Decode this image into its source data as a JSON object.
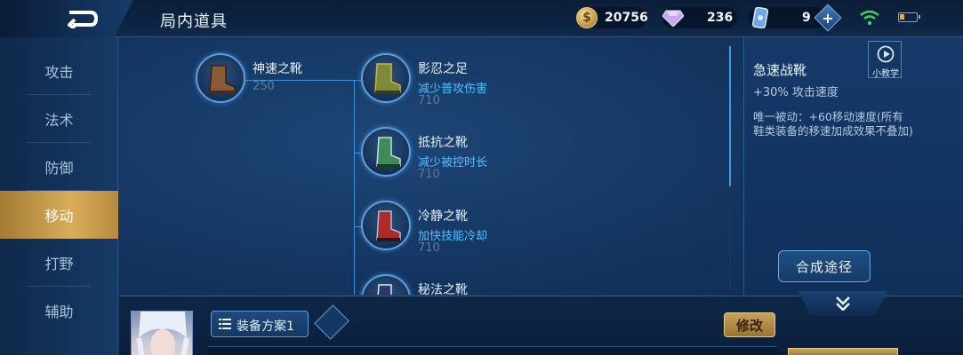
{
  "header": {
    "title": "局内道具",
    "currencies": {
      "gold": "20756",
      "gems": "236",
      "tickets": "9"
    },
    "battery_level": 0.3
  },
  "sidebar": {
    "items": [
      {
        "label": "攻击",
        "active": false
      },
      {
        "label": "法术",
        "active": false
      },
      {
        "label": "防御",
        "active": false
      },
      {
        "label": "移动",
        "active": true
      },
      {
        "label": "打野",
        "active": false
      },
      {
        "label": "辅助",
        "active": false
      }
    ]
  },
  "tree": {
    "base": {
      "name": "神速之靴",
      "price": "250"
    },
    "upgrades": [
      {
        "name": "影忍之足",
        "desc": "减少普攻伤害",
        "price": "710"
      },
      {
        "name": "抵抗之靴",
        "desc": "减少被控时长",
        "price": "710"
      },
      {
        "name": "冷静之靴",
        "desc": "加快技能冷却",
        "price": "710"
      },
      {
        "name": "秘法之靴",
        "desc": "",
        "price": ""
      }
    ]
  },
  "detail": {
    "name": "急速战靴",
    "stat": "+30% 攻击速度",
    "passive": "唯一被动：+60移动速度(所有鞋类装备的移速加成效果不叠加)",
    "tutorial_label": "小教学",
    "synth_label": "合成途径"
  },
  "bottom": {
    "plan_label": "装备方案1",
    "modify_label": "修改"
  },
  "colors": {
    "accent_blue": "#4ec0ff",
    "active_tab_gold": "#d8ad5a",
    "background": "#143560"
  }
}
